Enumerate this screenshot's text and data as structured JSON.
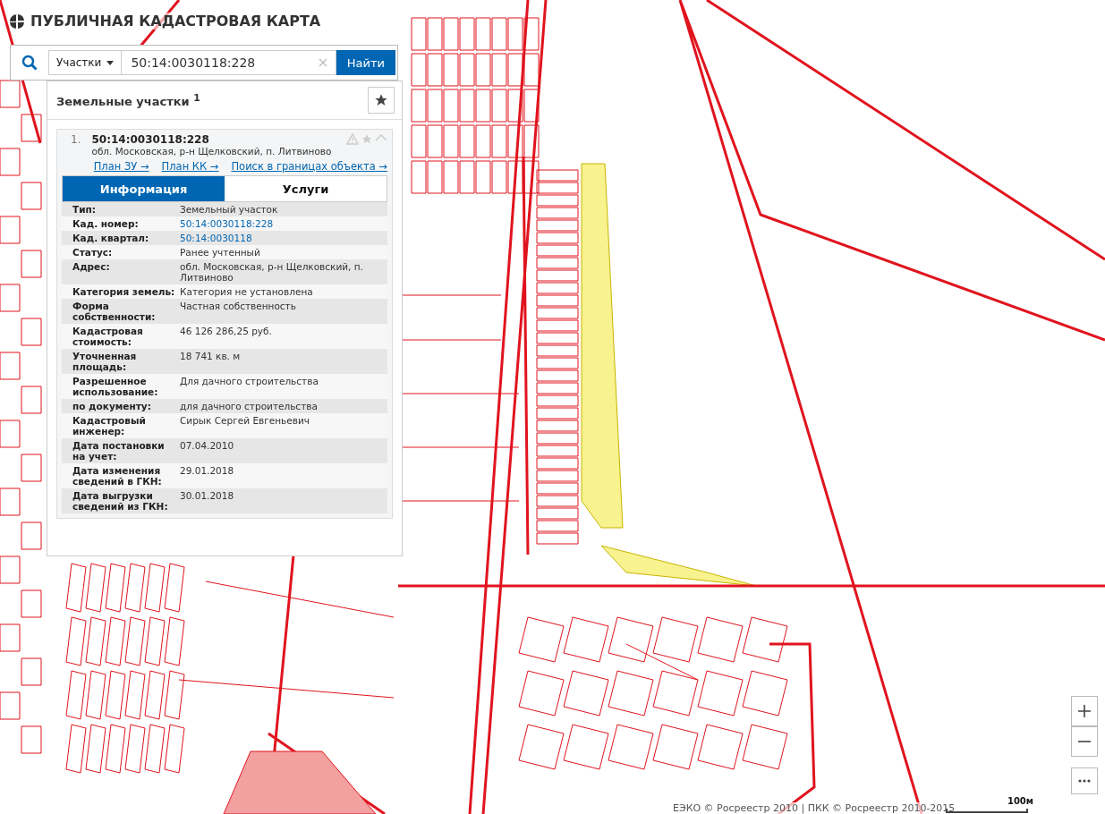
{
  "header": {
    "title": "ПУБЛИЧНАЯ КАДАСТРОВАЯ КАРТА"
  },
  "search": {
    "category": "Участки",
    "value": "50:14:0030118:228",
    "button": "Найти"
  },
  "results": {
    "title": "Земельные участки",
    "count": "1",
    "items": [
      {
        "index": "1.",
        "number": "50:14:0030118:228",
        "address": "обл. Московская, р-н Щелковский, п. Литвиново",
        "expanded": true,
        "links": [
          "План ЗУ →",
          "План КК →",
          "Поиск в границах объекта →"
        ],
        "tabs": [
          {
            "label": "Информация",
            "selected": true
          },
          {
            "label": "Услуги",
            "selected": false
          }
        ],
        "rows": [
          {
            "label": "Тип:",
            "value": "Земельный участок",
            "kind": "text"
          },
          {
            "label": "Кад. номер:",
            "value": "50:14:0030118:228",
            "kind": "link"
          },
          {
            "label": "Кад. квартал:",
            "value": "50:14:0030118",
            "kind": "link"
          },
          {
            "label": "Статус:",
            "value": "Ранее учтенный",
            "kind": "text"
          },
          {
            "label": "Адрес:",
            "value": "обл. Московская, р-н Щелковский, п. Литвиново",
            "kind": "text"
          },
          {
            "label": "Категория земель:",
            "value": "Категория не установлена",
            "kind": "text"
          },
          {
            "label": "Форма собственности:",
            "value": "Частная собственность",
            "kind": "text"
          },
          {
            "label": "Кадастровая стоимость:",
            "value": "46 126 286,25 руб.",
            "kind": "text"
          },
          {
            "label": "Уточненная площадь:",
            "value": "18 741 кв. м",
            "kind": "text"
          },
          {
            "label": "Разрешенное использование:",
            "value": "Для дачного строительства",
            "kind": "text"
          },
          {
            "label": "по документу:",
            "value": "для дачного строительства",
            "kind": "text"
          },
          {
            "label": "Кадастровый инженер:",
            "value": "Сирык Сергей Евгеньевич",
            "kind": "text"
          },
          {
            "label": "Дата постановки на учет:",
            "value": "07.04.2010",
            "kind": "text"
          },
          {
            "label": "Дата изменения сведений в ГКН:",
            "value": "29.01.2018",
            "kind": "text"
          },
          {
            "label": "Дата выгрузки сведений из ГКН:",
            "value": "30.01.2018",
            "kind": "text"
          }
        ]
      }
    ]
  },
  "attribution": "ЕЭКО © Росреестр 2010 | ПКК © Росреестр 2010-2015",
  "scale": {
    "label": "100м"
  }
}
